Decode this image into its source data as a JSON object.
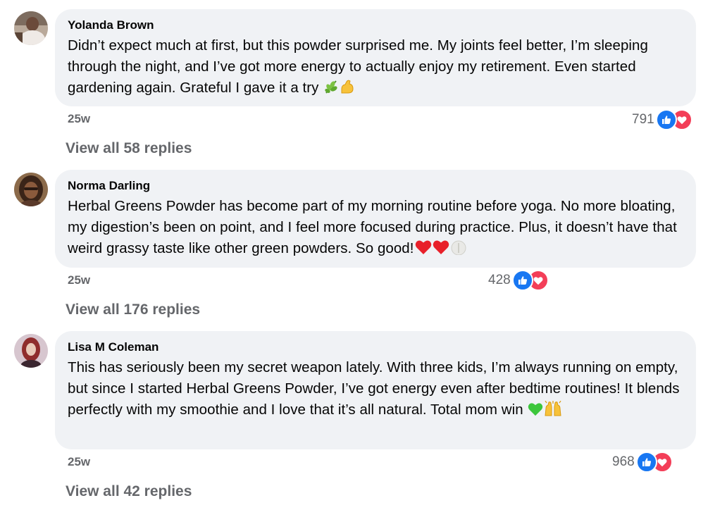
{
  "comments": [
    {
      "author": "Yolanda Brown",
      "text": "Didn’t expect much at first, but this powder surprised me. My joints feel better, I’m sleeping through the night, and I’ve got more energy to actually enjoy my retirement. Even started gardening again. Grateful I gave it a try",
      "emojis": [
        "herb-emoji",
        "flexed-biceps-emoji"
      ],
      "time": "25w",
      "reaction_count": "791",
      "reactions": [
        "like",
        "love"
      ],
      "replies_label": "View all 58 replies"
    },
    {
      "author": "Norma Darling",
      "text": "Herbal Greens Powder has become part of my morning routine before yoga. No more bloating, my digestion’s been on point, and I feel more focused during practice. Plus, it doesn’t have that weird grassy taste like other green powders. So good!",
      "emojis": [
        "red-heart-emoji",
        "red-heart-emoji",
        "white-heart-emoji"
      ],
      "time": "25w",
      "reaction_count": "428",
      "reactions": [
        "like",
        "love"
      ],
      "replies_label": "View all 176 replies"
    },
    {
      "author": "Lisa M Coleman",
      "text": "This has seriously been my secret weapon lately. With three kids, I’m always running on empty, but since I started Herbal Greens Powder, I’ve got energy even after bedtime routines! It blends perfectly with my smoothie and I love that it’s all natural. Total mom win",
      "emojis": [
        "green-heart-emoji",
        "raising-hands-emoji"
      ],
      "time": "25w",
      "reaction_count": "968",
      "reactions": [
        "like",
        "love"
      ],
      "replies_label": "View all 42 replies"
    }
  ],
  "colors": {
    "bubble": "#f0f2f5",
    "secondary_text": "#65676b",
    "like_blue": "#1877f2",
    "love_red": "#f33e58"
  }
}
